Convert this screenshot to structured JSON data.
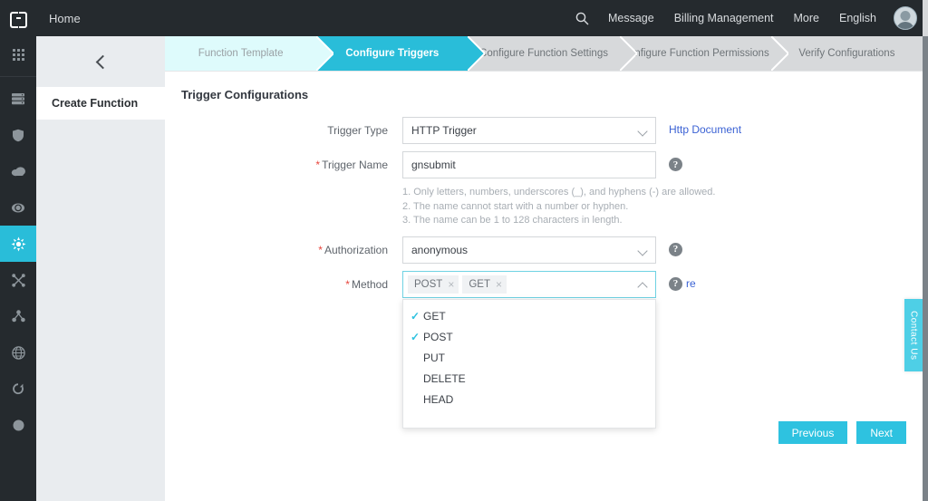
{
  "header": {
    "logo_name": "bracket-logo",
    "home_label": "Home",
    "search_icon": "search-icon",
    "nav": [
      {
        "label": "Message"
      },
      {
        "label": "Billing Management"
      },
      {
        "label": "More"
      },
      {
        "label": "English"
      }
    ],
    "avatar_name": "user-avatar"
  },
  "rail": {
    "items": [
      {
        "icon": "apps-grid-icon",
        "active": false
      },
      {
        "icon": "server-stack-icon",
        "active": false
      },
      {
        "icon": "shield-icon",
        "active": false
      },
      {
        "icon": "cloud-icon",
        "active": false
      },
      {
        "icon": "cloud-storage-icon",
        "active": false
      },
      {
        "icon": "function-compute-icon",
        "active": true
      },
      {
        "icon": "network-cross-icon",
        "active": false
      },
      {
        "icon": "share-nodes-icon",
        "active": false
      },
      {
        "icon": "globe-icon",
        "active": false
      },
      {
        "icon": "refresh-cloud-icon",
        "active": false
      },
      {
        "icon": "circle-icon",
        "active": false
      }
    ]
  },
  "subpanel": {
    "collapse_icon": "chevron-left-icon",
    "item_label": "Create Function"
  },
  "stepper": {
    "steps": [
      {
        "label": "Function Template",
        "state": "done"
      },
      {
        "label": "Configure Triggers",
        "state": "active"
      },
      {
        "label": "Configure Function Settings",
        "state": "todo"
      },
      {
        "label": "Configure Function Permissions",
        "state": "todo"
      },
      {
        "label": "Verify Configurations",
        "state": "todo"
      }
    ]
  },
  "form": {
    "title": "Trigger Configurations",
    "trigger_type": {
      "label": "Trigger Type",
      "value": "HTTP Trigger",
      "link_label": "Http Document"
    },
    "trigger_name": {
      "label": "Trigger Name",
      "required_mark": "*",
      "value": "gnsubmit",
      "placeholder": "",
      "help": "?",
      "hints": [
        "1. Only letters, numbers, underscores (_), and hyphens (-) are allowed.",
        "2. The name cannot start with a number or hyphen.",
        "3. The name can be 1 to 128 characters in length."
      ]
    },
    "authorization": {
      "label": "Authorization",
      "required_mark": "*",
      "value": "anonymous",
      "help": "?"
    },
    "method": {
      "label": "Method",
      "required_mark": "*",
      "help": "?",
      "tags": [
        {
          "label": "POST",
          "remove_icon": "close-icon"
        },
        {
          "label": "GET",
          "remove_icon": "close-icon"
        }
      ],
      "options": [
        {
          "label": "GET",
          "checked": true
        },
        {
          "label": "POST",
          "checked": true
        },
        {
          "label": "PUT",
          "checked": false
        },
        {
          "label": "DELETE",
          "checked": false
        },
        {
          "label": "HEAD",
          "checked": false
        }
      ],
      "obscured_link_fragment": "re"
    }
  },
  "footer": {
    "previous_label": "Previous",
    "next_label": "Next"
  },
  "contact_tab": {
    "label": "Contact Us"
  },
  "colors": {
    "accent_cyan": "#29bdd9",
    "dark_chrome": "#252a2e",
    "panel_gray": "#e9ecef",
    "link_blue": "#3b62d4",
    "required_red": "#e8453c",
    "step_done_bg": "#defbfc",
    "step_todo_bg": "#d7d9db"
  }
}
